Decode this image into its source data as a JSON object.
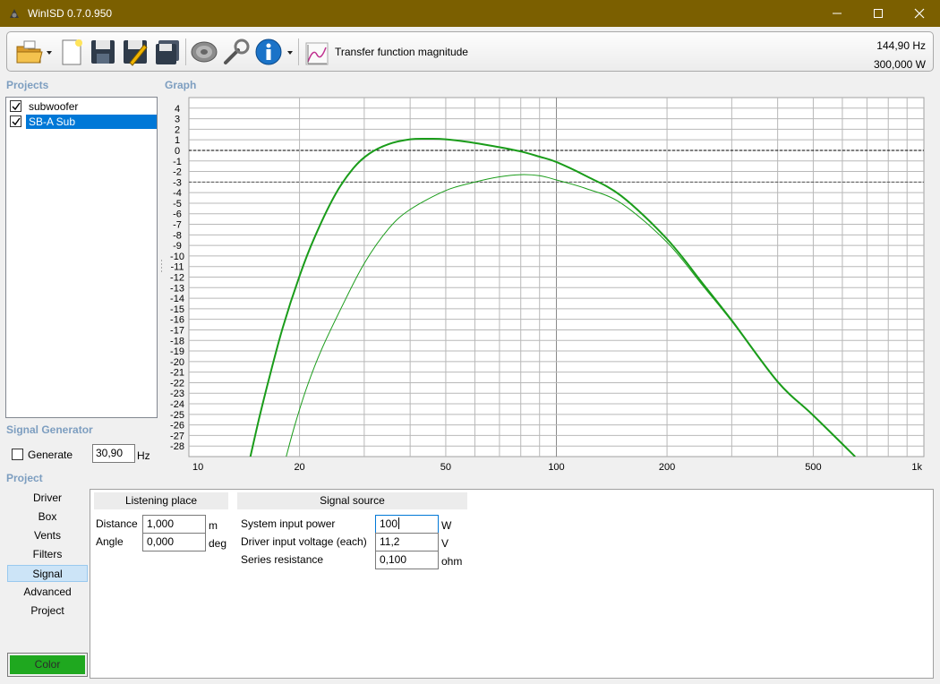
{
  "window": {
    "title": "WinISD 0.7.0.950"
  },
  "toolbar": {
    "icons": [
      "open-folder-icon",
      "new-document-icon",
      "save-icon",
      "save-as-icon",
      "save-all-icon",
      "driver-icon",
      "tools-icon",
      "info-icon",
      "transfer-function-icon"
    ],
    "mode_label": "Transfer function magnitude",
    "readout_frequency": "144,90 Hz",
    "readout_power": "300,000 W"
  },
  "projects": {
    "title": "Projects",
    "items": [
      {
        "label": "subwoofer",
        "checked": true,
        "selected": false
      },
      {
        "label": "SB-A Sub",
        "checked": true,
        "selected": true
      }
    ]
  },
  "signal_generator": {
    "title": "Signal Generator",
    "generate_label": "Generate",
    "generate_checked": false,
    "frequency": "30,90",
    "frequency_unit": "Hz"
  },
  "graph": {
    "title": "Graph"
  },
  "chart_data": {
    "type": "line",
    "x_scale": "log",
    "xlim": [
      10,
      1000
    ],
    "ylim": [
      -29,
      5
    ],
    "x_ticks": [
      "10",
      "20",
      "50",
      "100",
      "200",
      "500",
      "1k"
    ],
    "y_ticks": [
      "4",
      "3",
      "2",
      "1",
      "0",
      "-1",
      "-2",
      "-3",
      "-4",
      "-5",
      "-6",
      "-7",
      "-8",
      "-9",
      "-10",
      "-11",
      "-12",
      "-13",
      "-14",
      "-15",
      "-16",
      "-17",
      "-18",
      "-19",
      "-20",
      "-21",
      "-22",
      "-23",
      "-24",
      "-25",
      "-26",
      "-27",
      "-28"
    ],
    "reference_lines": [
      0,
      -3
    ],
    "grid": true,
    "series": [
      {
        "color": "#1a9c1a",
        "width": 2,
        "x": [
          14.7,
          15.5,
          16.5,
          18,
          20,
          22,
          25,
          28,
          31,
          35,
          40,
          45,
          50,
          60,
          70,
          80,
          90,
          100,
          120,
          150,
          200,
          250,
          300,
          400,
          500,
          650
        ],
        "y": [
          -29,
          -25.5,
          -21.7,
          -16.8,
          -11.9,
          -8.2,
          -4.2,
          -1.7,
          -0.3,
          0.6,
          1.05,
          1.1,
          1.05,
          0.7,
          0.3,
          -0.1,
          -0.6,
          -1.1,
          -2.4,
          -4.3,
          -8.4,
          -12.6,
          -16.1,
          -21.9,
          -25.1,
          -29
        ]
      },
      {
        "color": "#1a9c1a",
        "width": 1,
        "x": [
          18.4,
          19.5,
          21,
          23,
          26,
          30,
          35,
          40,
          50,
          60,
          70,
          80,
          90,
          100,
          120,
          150,
          200,
          250,
          300,
          400,
          500,
          650
        ],
        "y": [
          -29,
          -25.8,
          -22.3,
          -18.8,
          -14.9,
          -10.7,
          -7.4,
          -5.6,
          -3.8,
          -3,
          -2.5,
          -2.3,
          -2.4,
          -2.8,
          -3.6,
          -5,
          -8.7,
          -12.8,
          -16.2,
          -21.9,
          -25.1,
          -29
        ]
      }
    ]
  },
  "project": {
    "title": "Project",
    "tabs": [
      "Driver",
      "Box",
      "Vents",
      "Filters",
      "Signal",
      "Advanced",
      "Project"
    ],
    "active_tab": "Signal",
    "color_label": "Color",
    "color": "#1fa81f"
  },
  "listening_place": {
    "title": "Listening place",
    "distance_label": "Distance",
    "distance_value": "1,000",
    "distance_unit": "m",
    "angle_label": "Angle",
    "angle_value": "0,000",
    "angle_unit": "deg"
  },
  "signal_source": {
    "title": "Signal source",
    "power_label": "System input power",
    "power_value": "100",
    "power_unit": "W",
    "voltage_label": "Driver input voltage (each)",
    "voltage_value": "11,2",
    "voltage_unit": "V",
    "resistance_label": "Series resistance",
    "resistance_value": "0,100",
    "resistance_unit": "ohm"
  }
}
